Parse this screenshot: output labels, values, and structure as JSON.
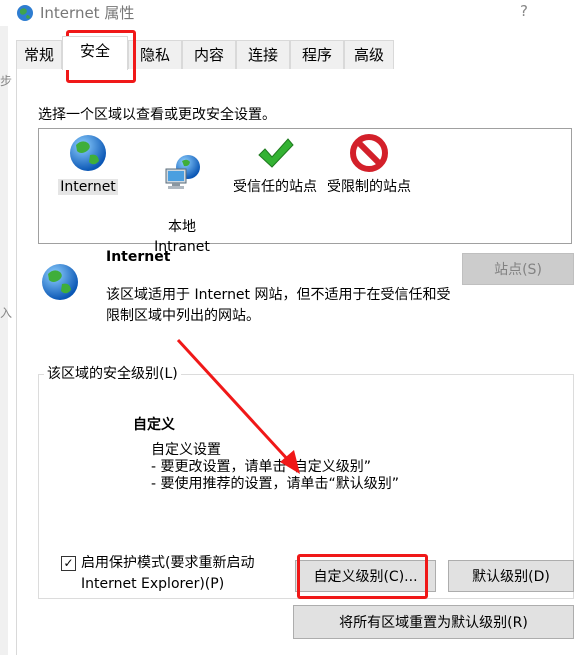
{
  "window": {
    "title": "Internet 属性",
    "help": "?"
  },
  "left_strip": {
    "glyph_top": "步",
    "glyph_bottom": "入"
  },
  "tabs": [
    {
      "label": "常规"
    },
    {
      "label": "安全"
    },
    {
      "label": "隐私"
    },
    {
      "label": "内容"
    },
    {
      "label": "连接"
    },
    {
      "label": "程序"
    },
    {
      "label": "高级"
    }
  ],
  "security": {
    "prompt": "选择一个区域以查看或更改安全设置。",
    "zones": [
      {
        "label": "Internet",
        "icon": "globe-icon"
      },
      {
        "label": "本地\nIntranet",
        "icon": "intranet-icon"
      },
      {
        "label": "受信任的站点",
        "icon": "checkmark-icon"
      },
      {
        "label": "受限制的站点",
        "icon": "restricted-icon"
      }
    ],
    "selected_zone": {
      "title": "Internet",
      "description": "该区域适用于 Internet 网站，但不适用于在受信任和受限制区域中列出的网站。",
      "sites_button": "站点(S)"
    },
    "level_group": {
      "legend": "该区域的安全级别(L)",
      "level_name": "自定义",
      "lines": [
        "自定义设置",
        "- 要更改设置，请单击“自定义级别”",
        "- 要使用推荐的设置，请单击“默认级别”"
      ],
      "protected_mode_label": "启用保护模式(要求重新启动\nInternet Explorer)(P)",
      "protected_mode_checked": true,
      "custom_level_button": "自定义级别(C)...",
      "default_level_button": "默认级别(D)",
      "reset_all_button": "将所有区域重置为默认级别(R)"
    }
  },
  "annotation_color": "#f01818"
}
